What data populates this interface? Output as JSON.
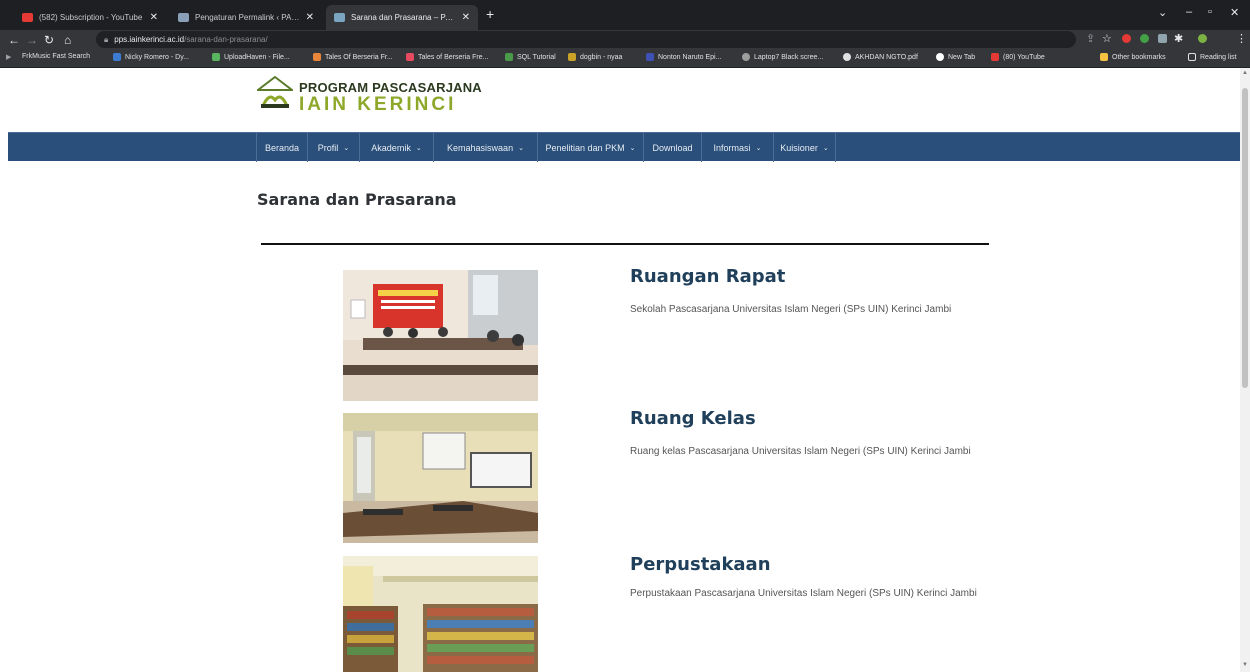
{
  "browser": {
    "tabs": [
      {
        "title": "(582) Subscription - YouTube",
        "favicon_color": "#e53935"
      },
      {
        "title": "Pengaturan Permalink ‹ PASCASA",
        "favicon_color": "#8aa0b8"
      },
      {
        "title": "Sarana dan Prasarana – PASCASA",
        "favicon_color": "#7aa6c2"
      }
    ],
    "new_tab": "+",
    "address": {
      "domain": "pps.iainkerinci.ac.id",
      "path": "/sarana-dan-prasarana/"
    },
    "bookmarks": [
      {
        "label": "FrkMusic Fast Search",
        "color": "#4caf50"
      },
      {
        "label": "Nicky Romero - Dy...",
        "color": "#3d7bd1"
      },
      {
        "label": "UploadHaven - File...",
        "color": "#57b65f"
      },
      {
        "label": "Tales Of Berseria Fr...",
        "color": "#e8873a"
      },
      {
        "label": "Tales of Berseria Fre...",
        "color": "#e84a5f"
      },
      {
        "label": "SQL Tutorial",
        "color": "#4a9a4a"
      },
      {
        "label": "dogbin - nyaa",
        "color": "#c9a227"
      },
      {
        "label": "Nonton Naruto Epi...",
        "color": "#3f51b5"
      },
      {
        "label": "Laptop7 Black scree...",
        "color": "#9e9e9e"
      },
      {
        "label": "AKHDAN NGTO.pdf",
        "color": "#e0e0e0"
      },
      {
        "label": "New Tab",
        "color": "#ffffff"
      },
      {
        "label": "(80) YouTube",
        "color": "#e53935"
      }
    ],
    "other_bookmarks": "Other bookmarks",
    "reading_list": "Reading list"
  },
  "site": {
    "logo": {
      "line1": "PROGRAM PASCASARJANA",
      "line2": "IAIN KERINCI",
      "tagline": "KERINCI"
    },
    "nav": [
      {
        "label": "Beranda",
        "dropdown": false
      },
      {
        "label": "Profil",
        "dropdown": true
      },
      {
        "label": "Akademik",
        "dropdown": true
      },
      {
        "label": "Kemahasiswaan",
        "dropdown": true
      },
      {
        "label": "Penelitian dan PKM",
        "dropdown": true
      },
      {
        "label": "Download",
        "dropdown": false
      },
      {
        "label": "Informasi",
        "dropdown": true
      },
      {
        "label": "Kuisioner",
        "dropdown": true
      }
    ],
    "chevron": "⌄",
    "page_title": "Sarana dan Prasarana",
    "facilities": [
      {
        "title": "Ruangan Rapat",
        "description": "Sekolah Pascasarjana Universitas Islam Negeri (SPs UIN) Kerinci Jambi"
      },
      {
        "title": "Ruang Kelas",
        "description": "Ruang kelas Pascasarjana Universitas Islam Negeri (SPs UIN) Kerinci Jambi"
      },
      {
        "title": "Perpustakaan",
        "description": "Perpustakaan Pascasarjana Universitas Islam Negeri (SPs UIN) Kerinci Jambi"
      }
    ]
  },
  "colors": {
    "nav_bg": "#2a4f7a",
    "logo_green": "#8da82a",
    "facility_title": "#1f3f5a"
  }
}
